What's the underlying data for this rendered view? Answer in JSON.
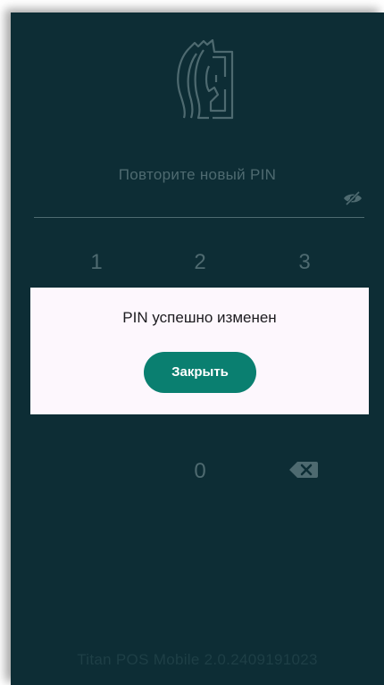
{
  "pin_screen": {
    "prompt": "Повторите новый PIN",
    "keys": {
      "k1": "1",
      "k2": "2",
      "k3": "3",
      "k0": "0"
    },
    "version": "Titan POS Mobile 2.0.2409191023"
  },
  "dialog": {
    "message": "PIN успешно изменен",
    "close_label": "Закрыть"
  },
  "icons": {
    "logo": "spartan-helmet-logo",
    "visibility": "eye-off-icon",
    "delete": "backspace-icon"
  },
  "colors": {
    "background": "#0d2d35",
    "muted_text": "#4e6a70",
    "dialog_background": "#fdf7fd",
    "accent": "#0a7f70"
  }
}
